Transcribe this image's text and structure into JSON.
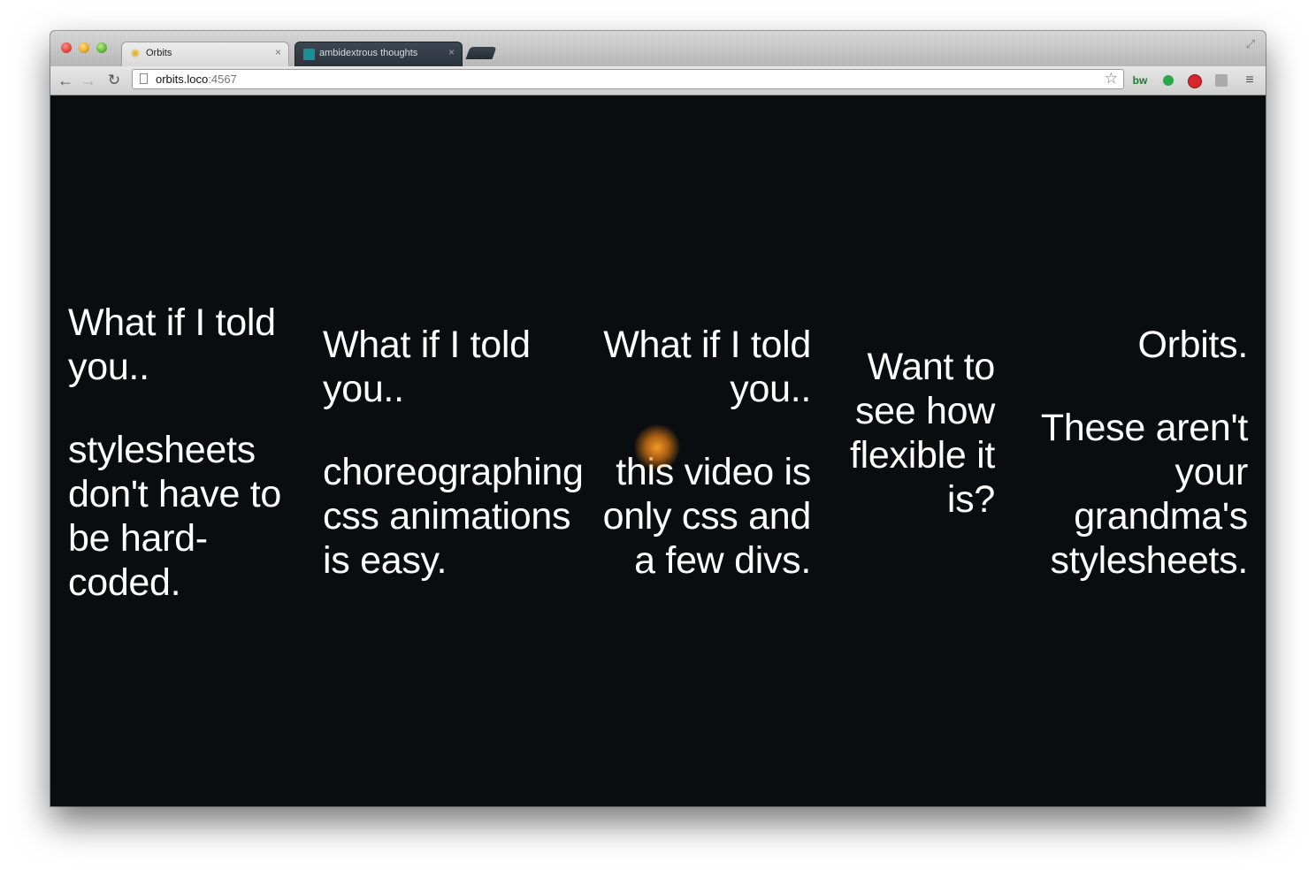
{
  "browser": {
    "tabs": [
      {
        "label": "Orbits",
        "icon": "orbits-favicon-icon",
        "active": true
      },
      {
        "label": "ambidextrous thoughts",
        "icon": "ambidextrous-favicon-icon",
        "active": false
      }
    ],
    "tab_close_glyph": "×",
    "url": {
      "host": "orbits.loco",
      "port": ":4567"
    },
    "extensions": [
      {
        "name": "bw-extension-icon",
        "label": "bw"
      }
    ]
  },
  "slides": [
    {
      "heading": "What if I told you..",
      "body": "stylesheets don't have to be hard-coded."
    },
    {
      "heading": "What if I told you..",
      "body": "choreographing css animations is easy."
    },
    {
      "heading": "What if I told you..",
      "body": "this video is only css and a few divs."
    },
    {
      "heading": "Want to see how flexible it is?",
      "body": ""
    },
    {
      "heading": "Orbits.",
      "body": "These aren't your grandma's stylesheets."
    }
  ],
  "colors": {
    "page_background": "#0a0d10",
    "text": "#ffffff",
    "cursor_glow": "#f0a030"
  }
}
